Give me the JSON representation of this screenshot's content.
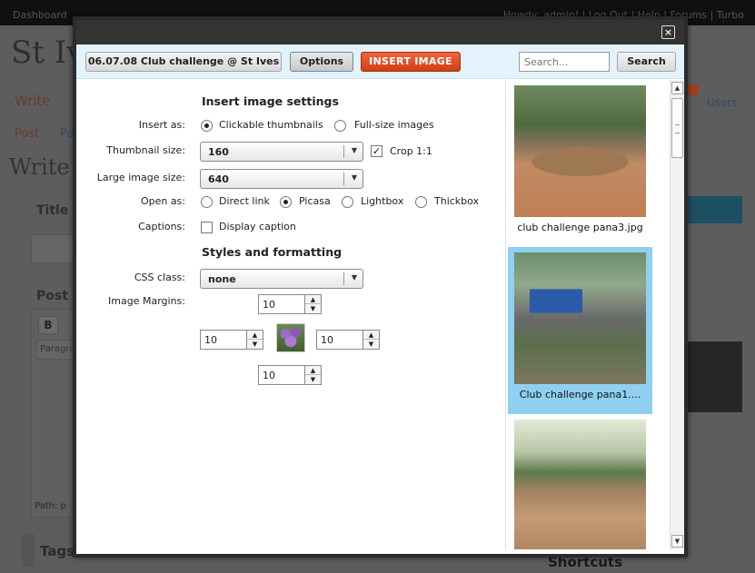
{
  "background": {
    "admin_bar": {
      "dashboard": "Dashboard",
      "right_text": "Howdy, admin! | Log Out | Help | Forums | Turbo"
    },
    "site_title": "St Ives",
    "tabs": {
      "write": "Write",
      "users": "Users"
    },
    "subtabs": {
      "post": "Post",
      "pages": "Pa"
    },
    "page_heading": "Write",
    "title_label": "Title",
    "post_label": "Post",
    "editor": {
      "bold": "B",
      "format": "Paragraph",
      "path": "Path: p"
    },
    "tags_label": "Tags",
    "shortcuts_label": "Shortcuts"
  },
  "modal": {
    "close_label": "×",
    "toolbar": {
      "album_button": "06.07.08 Club challenge @ St Ives",
      "options_button": "Options",
      "insert_button": "INSERT IMAGE",
      "search_placeholder": "Search...",
      "search_button": "Search"
    },
    "settings": {
      "insert_title": "Insert image settings",
      "insert_as_label": "Insert as:",
      "insert_as_options": [
        "Clickable thumbnails",
        "Full-size images"
      ],
      "insert_as_selected": "Clickable thumbnails",
      "thumbnail_size_label": "Thumbnail size:",
      "thumbnail_size_value": "160",
      "crop_label": "Crop 1:1",
      "crop_checked": true,
      "large_size_label": "Large image size:",
      "large_size_value": "640",
      "open_as_label": "Open as:",
      "open_as_options": [
        "Direct link",
        "Picasa",
        "Lightbox",
        "Thickbox"
      ],
      "open_as_selected": "Picasa",
      "captions_label": "Captions:",
      "display_caption_label": "Display caption",
      "display_caption_checked": false,
      "styles_title": "Styles and formatting",
      "css_class_label": "CSS class:",
      "css_class_value": "none",
      "margins_label": "Image Margins:",
      "margins": {
        "top": "10",
        "left": "10",
        "right": "10",
        "bottom": "10"
      }
    },
    "gallery": [
      {
        "caption": "club challenge pana3.jpg",
        "selected": false
      },
      {
        "caption": "Club challenge pana1....",
        "selected": true
      },
      {
        "caption": "",
        "selected": false
      }
    ]
  }
}
